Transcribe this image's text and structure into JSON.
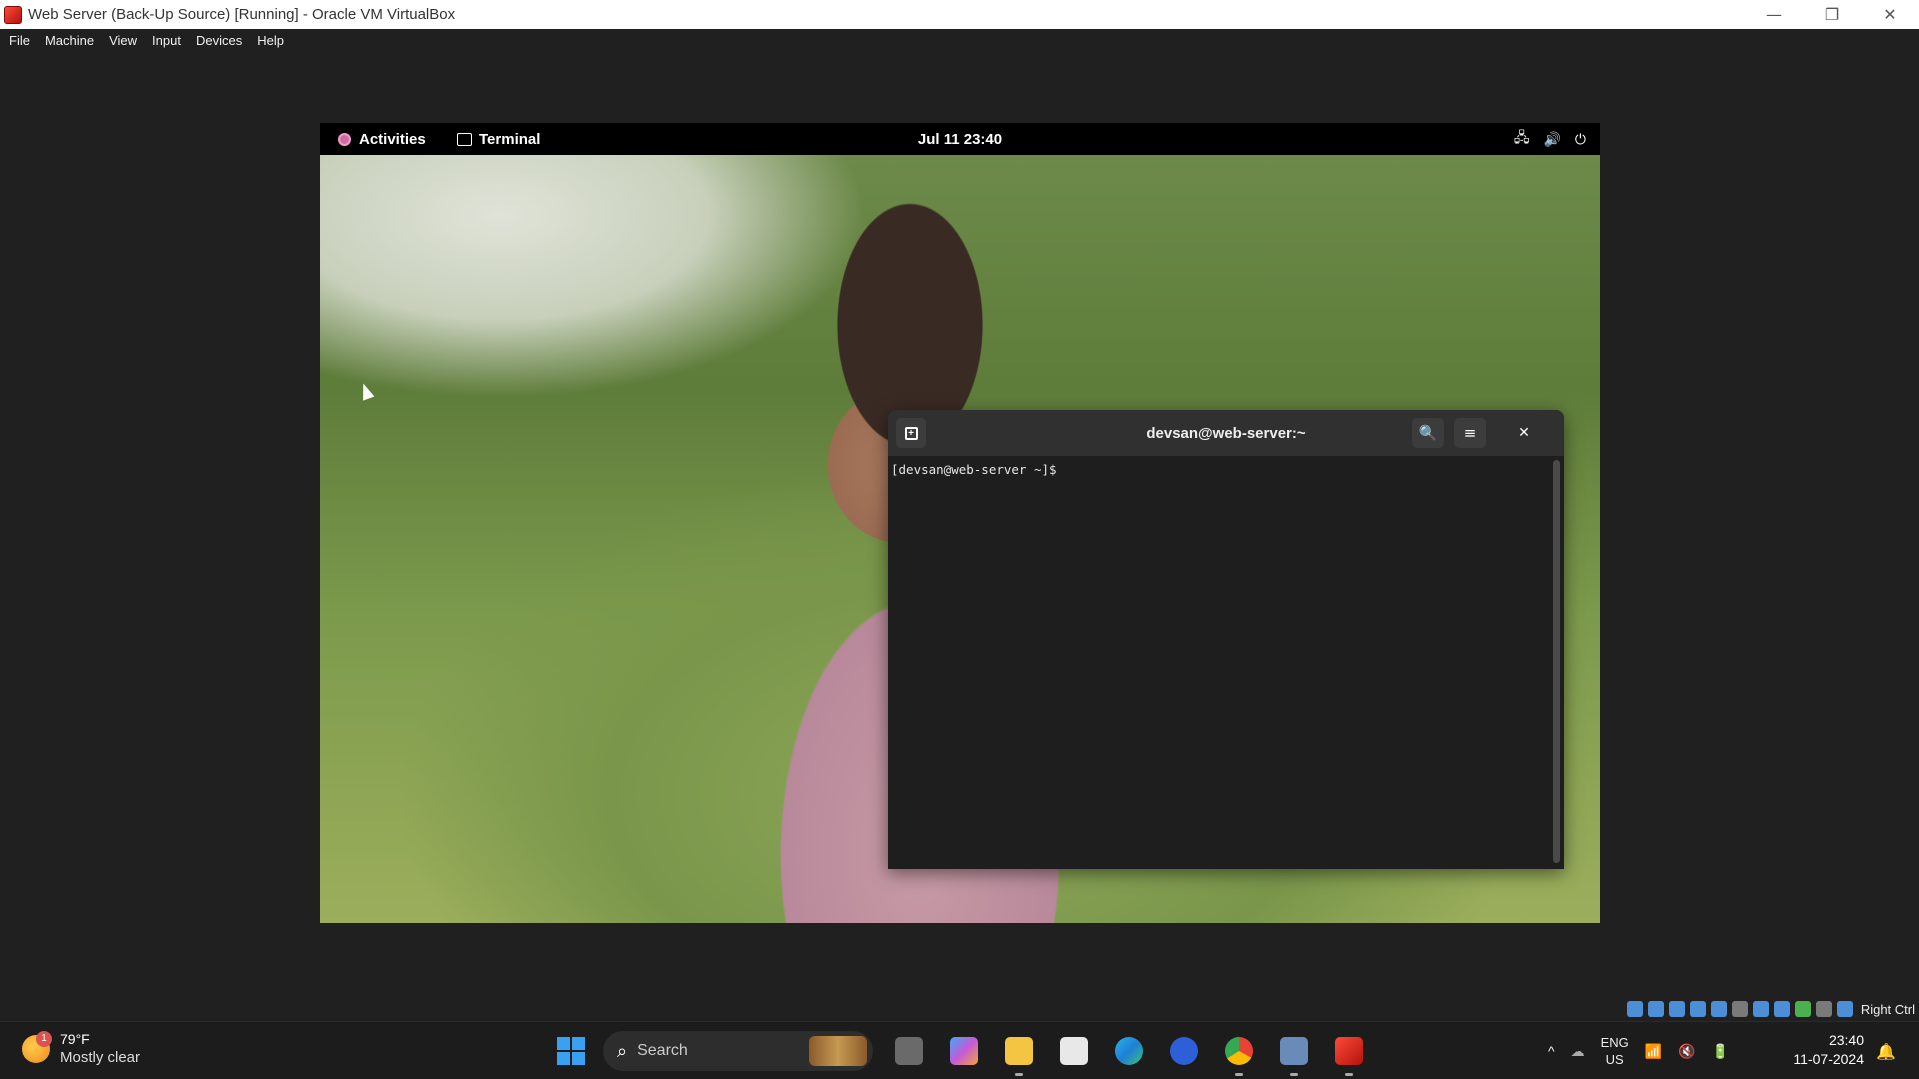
{
  "host_window": {
    "title": "Web Server (Back-Up Source) [Running] - Oracle VM VirtualBox",
    "controls": {
      "minimize": "—",
      "restore": "❐",
      "close": "✕"
    }
  },
  "menu": [
    "File",
    "Machine",
    "View",
    "Input",
    "Devices",
    "Help"
  ],
  "gnome": {
    "activities": "Activities",
    "app": "Terminal",
    "clock": "Jul 11  23:40",
    "tray": {
      "network": "🖧",
      "volume": "🔊",
      "power": "⏻"
    }
  },
  "terminal": {
    "title": "devsan@web-server:~",
    "new_tab_icon": "+",
    "search_icon": "🔍",
    "menu_icon": "≡",
    "close_icon": "✕",
    "prompt": "[devsan@web-server ~]$"
  },
  "vbox_status": {
    "host_key": "Right Ctrl"
  },
  "taskbar": {
    "weather_badge": "1",
    "temperature": "79°F",
    "weather": "Mostly clear",
    "search_placeholder": "Search",
    "tray_chevron": "^",
    "lang_top": "ENG",
    "lang_bottom": "US",
    "time": "23:40",
    "date": "11-07-2024",
    "wifi": "📶",
    "sound": "🔇",
    "battery": "🔋",
    "bell": "🔔"
  },
  "colors": {
    "accent": "#3aa0f0",
    "terminal_bg": "#1e1e1e",
    "header_bg": "#303030"
  }
}
